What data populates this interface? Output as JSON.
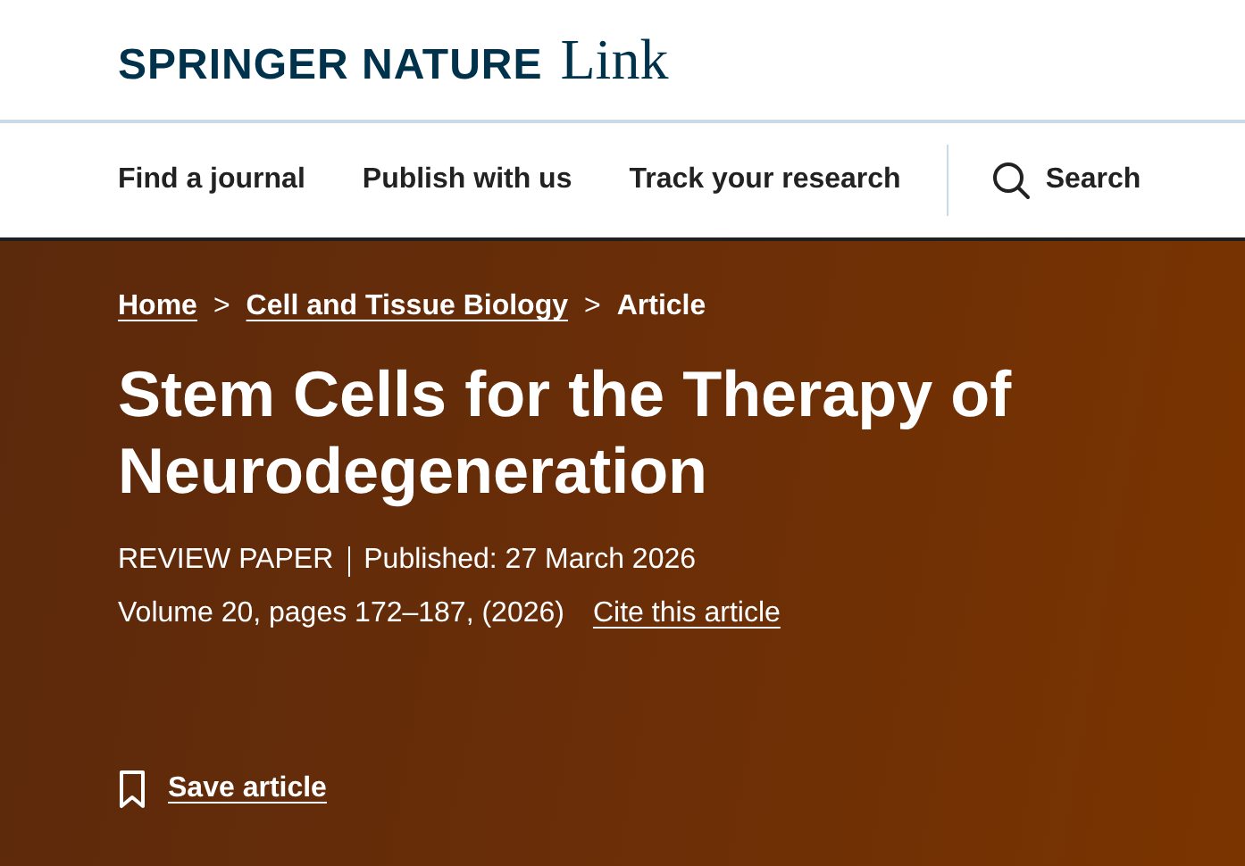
{
  "header": {
    "logo": {
      "brand": "SPRINGER NATURE",
      "product": "Link"
    }
  },
  "nav": {
    "items": [
      "Find a journal",
      "Publish with us",
      "Track your research"
    ],
    "search": "Search"
  },
  "breadcrumb": [
    {
      "label": "Home",
      "link": true
    },
    {
      "label": "Cell and Tissue Biology",
      "link": true
    },
    {
      "label": "Article",
      "link": false
    }
  ],
  "breadcrumb_separator": ">",
  "article": {
    "title": "Stem Cells for the Therapy of Neurodegeneration",
    "type": "REVIEW PAPER",
    "published": "Published: 27 March 2026",
    "volume": "Volume 20, pages 172–187, (2026)",
    "cite": "Cite this article",
    "save": "Save article"
  }
}
